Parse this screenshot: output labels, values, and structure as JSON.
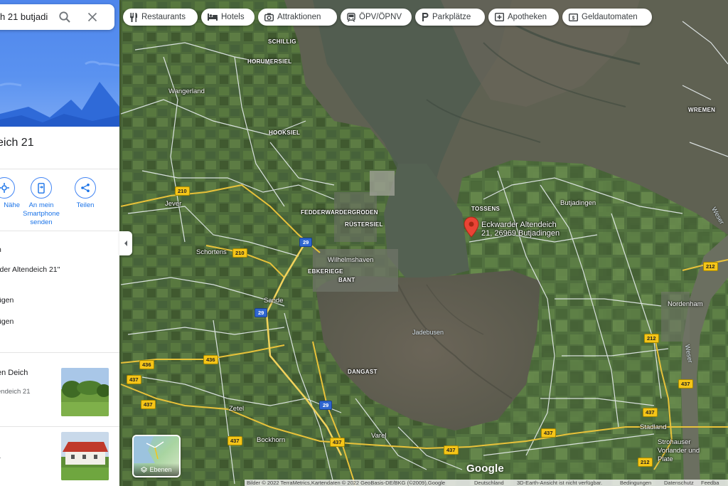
{
  "search": {
    "query": "h 21 butjadi"
  },
  "place_panel": {
    "title": "eich 21",
    "actions": [
      {
        "label": "Nähe",
        "icon": "nearby-icon"
      },
      {
        "label": "An mein Smartphone senden",
        "icon": "send-to-phone-icon"
      },
      {
        "label": "Teilen",
        "icon": "share-icon"
      }
    ],
    "list_lines": [
      "n",
      "rder Altendeich 21\"",
      "ügen",
      "ügen"
    ],
    "cards": [
      {
        "title": "en Deich",
        "subtitle": "endeich 21"
      },
      {
        "title": "",
        "subtitle": "1"
      }
    ]
  },
  "chips": [
    {
      "label": "Restaurants",
      "icon": "fork-knife-icon"
    },
    {
      "label": "Hotels",
      "icon": "bed-icon"
    },
    {
      "label": "Attraktionen",
      "icon": "camera-icon"
    },
    {
      "label": "ÖPV/ÖPNV",
      "icon": "transit-icon"
    },
    {
      "label": "Parkplätze",
      "icon": "parking-icon"
    },
    {
      "label": "Apotheken",
      "icon": "pharmacy-icon"
    },
    {
      "label": "Geldautomaten",
      "icon": "atm-icon"
    }
  ],
  "pin": {
    "label_line1": "Eckwarder Altendeich",
    "label_line2": "21, 26969 Butjadingen",
    "color": "#ea4335"
  },
  "map_places": {
    "small": [
      "SCHILLIG",
      "HORUMERSIEL",
      "HOOKSIEL",
      "FEDDERWARDERGRODEN",
      "RÜSTERSIEL",
      "EBKERIEGE",
      "BANT",
      "DANGAST",
      "TOSSENS",
      "WREMEN"
    ],
    "towns": [
      "Wangerland",
      "Jever",
      "Schortens",
      "Wilhelmshaven",
      "Sande",
      "Zetel",
      "Bockhorn",
      "Varel",
      "Butjadingen",
      "Nordenham",
      "Stadland",
      "Strohauser Vorlander und Plate"
    ],
    "water": [
      "Jadebusen",
      "Weser"
    ]
  },
  "roads": {
    "b210": "210",
    "b436": "436",
    "b437": "437",
    "b212": "212",
    "a29": "29"
  },
  "layers_button": {
    "label": "Ebenen"
  },
  "brand": "Google",
  "footer": {
    "imagery": "Bilder © 2022 TerraMetrics,Kartendaten © 2022 GeoBasis-DE/BKG (©2009),Google",
    "country": "Deutschland",
    "notice": "3D-Earth-Ansicht ist nicht verfügbar.",
    "terms": "Bedingungen",
    "privacy": "Datenschutz",
    "feedback": "Feedba"
  },
  "colors": {
    "accent": "#1a73e8",
    "header_blue": "#4f86ec",
    "road_yellow": "#f5c518",
    "autobahn_blue": "#2f66d0"
  }
}
